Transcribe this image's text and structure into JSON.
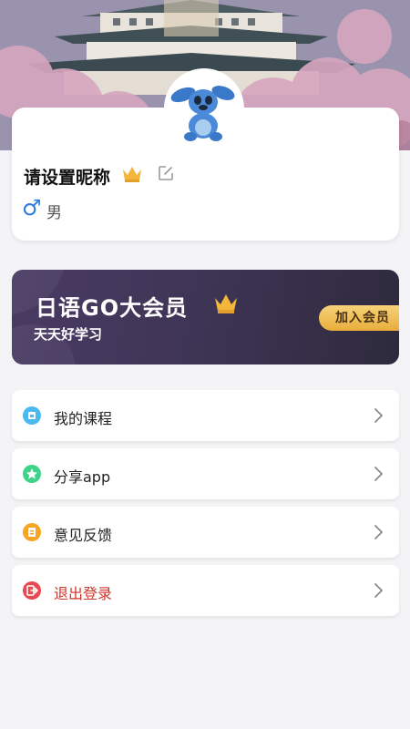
{
  "profile": {
    "nickname": "请设置昵称",
    "gender_symbol": "♂",
    "gender": "男"
  },
  "vip": {
    "title": "日语GO大会员",
    "subtitle": "天天好学习",
    "join_label": "加入会员"
  },
  "menu": [
    {
      "label": "我的课程",
      "icon": "course-icon",
      "color": "#4bb8f0"
    },
    {
      "label": "分享app",
      "icon": "share-star-icon",
      "color": "#3fd38a"
    },
    {
      "label": "意见反馈",
      "icon": "feedback-icon",
      "color": "#f5a623"
    },
    {
      "label": "退出登录",
      "icon": "logout-icon",
      "color": "#e8484f"
    }
  ],
  "colors": {
    "accent_gold": "#e8ad3b",
    "danger": "#d0342c",
    "gender_blue": "#2f7ce0"
  }
}
